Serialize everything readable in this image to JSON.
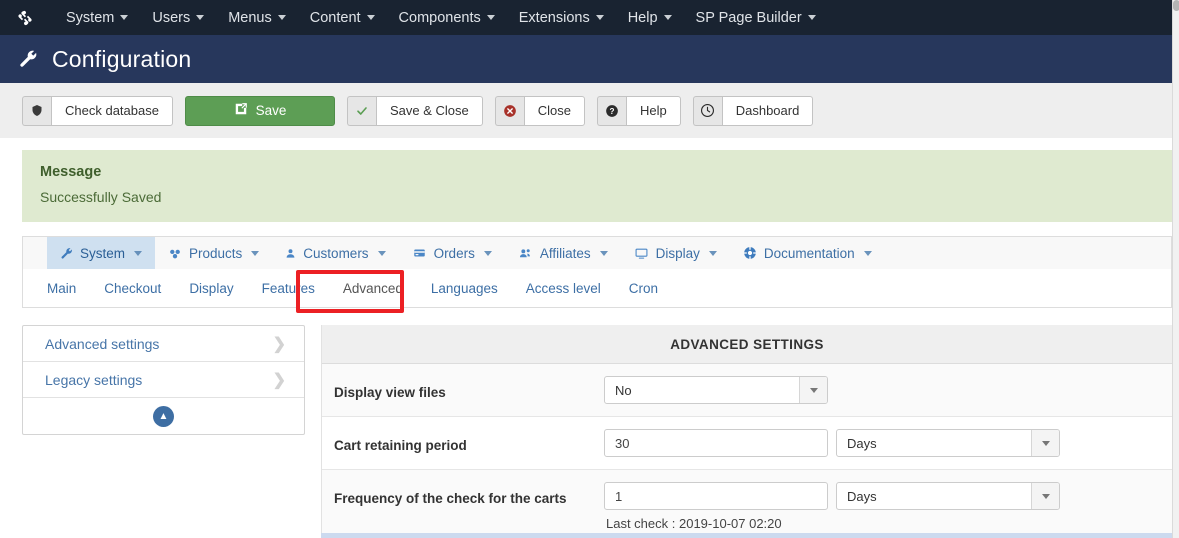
{
  "topbar": {
    "logo_icon": "joomla-logo-icon",
    "items": [
      {
        "label": "System",
        "caret": true
      },
      {
        "label": "Users",
        "caret": true
      },
      {
        "label": "Menus",
        "caret": true
      },
      {
        "label": "Content",
        "caret": true
      },
      {
        "label": "Components",
        "caret": true
      },
      {
        "label": "Extensions",
        "caret": true
      },
      {
        "label": "Help",
        "caret": true
      },
      {
        "label": "SP Page Builder",
        "caret": true
      }
    ]
  },
  "pagehead": {
    "icon": "wrench-icon",
    "title": "Configuration"
  },
  "toolbar": {
    "check_database_label": "Check database",
    "check_database_icon": "shield-icon",
    "save_label": "Save",
    "save_icon": "edit-square-icon",
    "save_close_label": "Save & Close",
    "save_close_icon": "checkmark-icon",
    "close_label": "Close",
    "close_icon": "circle-x-icon",
    "help_label": "Help",
    "help_icon": "circle-question-icon",
    "dashboard_label": "Dashboard",
    "dashboard_icon": "circle-clock-icon",
    "save_button_color": "#5d9e55"
  },
  "message": {
    "title": "Message",
    "body": "Successfully Saved",
    "background": "#dfead0",
    "text_color": "#3f5f2c"
  },
  "subnav": {
    "items": [
      {
        "label": "System",
        "icon": "wrench-icon",
        "caret": true,
        "active": true
      },
      {
        "label": "Products",
        "icon": "products-icon",
        "caret": true,
        "active": false
      },
      {
        "label": "Customers",
        "icon": "user-icon",
        "caret": true,
        "active": false
      },
      {
        "label": "Orders",
        "icon": "card-icon",
        "caret": true,
        "active": false
      },
      {
        "label": "Affiliates",
        "icon": "group-icon",
        "caret": true,
        "active": false
      },
      {
        "label": "Display",
        "icon": "monitor-icon",
        "caret": true,
        "active": false
      },
      {
        "label": "Documentation",
        "icon": "lifebuoy-icon",
        "caret": true,
        "active": false
      }
    ]
  },
  "tabs": {
    "items": [
      {
        "label": "Main",
        "active": false
      },
      {
        "label": "Checkout",
        "active": false
      },
      {
        "label": "Display",
        "active": false
      },
      {
        "label": "Features",
        "active": false
      },
      {
        "label": "Advanced",
        "active": true
      },
      {
        "label": "Languages",
        "active": false
      },
      {
        "label": "Access level",
        "active": false
      },
      {
        "label": "Cron",
        "active": false
      }
    ],
    "highlight_color": "#ec2024",
    "highlighted_tab": "Advanced"
  },
  "sidebar": {
    "items": [
      {
        "label": "Advanced settings",
        "chevron": "chevron-right-icon"
      },
      {
        "label": "Legacy settings",
        "chevron": "chevron-right-icon"
      }
    ],
    "collapse_icon": "chevron-up-circle-icon"
  },
  "main": {
    "panel_title": "ADVANCED SETTINGS",
    "rows": [
      {
        "label": "Display view files",
        "control": "select",
        "value": "No",
        "unit": null,
        "hint": null
      },
      {
        "label": "Cart retaining period",
        "control": "text+select",
        "value": "30",
        "unit": "Days",
        "hint": null
      },
      {
        "label": "Frequency of the check for the carts",
        "control": "text+select",
        "value": "1",
        "unit": "Days",
        "hint": "Last check : 2019-10-07 02:20"
      }
    ]
  }
}
